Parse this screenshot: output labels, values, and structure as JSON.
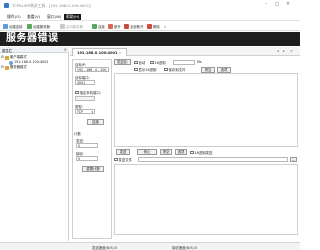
{
  "window": {
    "title": "TCP&UDP测试工具 - [192.168.0.100:4001]",
    "minimize": "–",
    "maximize": "□",
    "close": "✕"
  },
  "menu": {
    "items": [
      "操作(O)",
      "查看(V)",
      "窗口(W)",
      "帮助(H)"
    ]
  },
  "toolbar": {
    "create_connection": "创建连接",
    "create_server": "创建服务器",
    "start_server": "启动服务器",
    "connect": "连接",
    "disconnect": "断开",
    "disconnect_all": "全部断开",
    "delete": "删除",
    "more": "»"
  },
  "banner": {
    "text": "服务器错误"
  },
  "properties": {
    "title": "属性栏",
    "close": "×",
    "tree": [
      {
        "label": "客户端模式",
        "toggle": "⊟"
      },
      {
        "label": "192.168.0.100:4001"
      },
      {
        "label": "服务器模式",
        "toggle": "⊟"
      }
    ]
  },
  "tab": {
    "label": "192.168.0.100:4001",
    "close": "×",
    "nav_left": "◂",
    "nav_right": "▸",
    "nav_close": "×"
  },
  "config": {
    "target_ip_label": "目标IP:",
    "target_ip_value": "192 . 168 . 0 . 100",
    "target_port_label": "目标端口:",
    "target_port_value": "4001",
    "specify_local_port_label": "指定本机端口:",
    "local_port_value": "",
    "type_label": "类型:",
    "type_value": "TCP",
    "dropdown_arrow": "▾",
    "connect_button": "连接",
    "count_label": "计数",
    "sent_label": "发送:",
    "sent_value": "0",
    "recv_label": "接收:",
    "recv_value": "0",
    "reset_count_button": "重置计数"
  },
  "recv": {
    "send_to_label": "发送区:",
    "auto_label": "自动",
    "hex_label": "16进制",
    "interval_value": "",
    "unit_label": "Ms",
    "display_hex_label": "显示16进制",
    "save_to_file_label": "保存到文件",
    "clear_button": "清空",
    "options_button": "选项"
  },
  "send": {
    "send_button": "发送",
    "stop_button": "停止",
    "clear_button": "清空",
    "options_button": "选项",
    "hex_send_label": "16进制发送",
    "send_file_label": "发送文件",
    "file_path": "",
    "browse_button": "..."
  },
  "status": {
    "sent_speed": "发送速度(B/S):0",
    "recv_speed": "接收速度(B/S):0"
  },
  "colors": {
    "banner": "#1e1e1e",
    "accent": "#3a78c6"
  }
}
